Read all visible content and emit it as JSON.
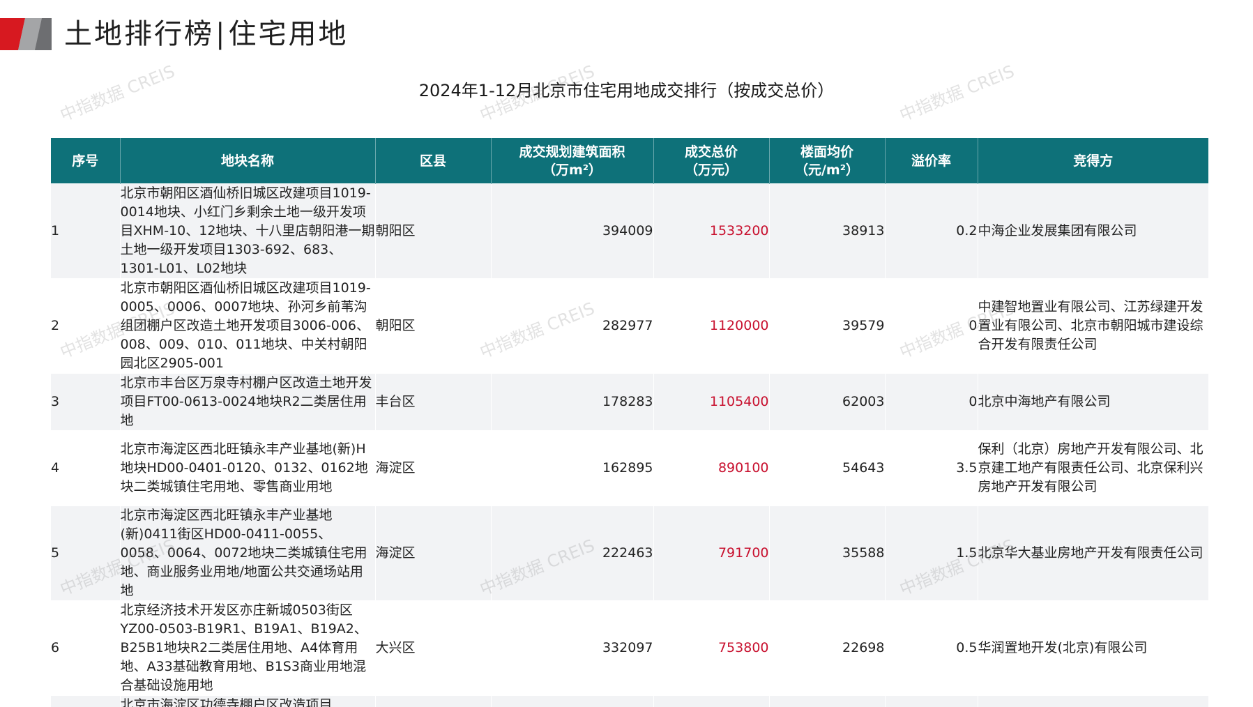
{
  "header": {
    "title_left": "土地排行榜",
    "title_sep": "|",
    "title_right": "住宅用地",
    "brand_red": "#d71920",
    "brand_gray": "#6d6e71"
  },
  "watermark": "中指数据 CREIS",
  "table": {
    "title": "2024年1-12月北京市住宅用地成交排行（按成交总价）",
    "header_color": "#0e7179",
    "price_color": "#c8102e",
    "columns": [
      {
        "line1": "序号",
        "line2": ""
      },
      {
        "line1": "地块名称",
        "line2": ""
      },
      {
        "line1": "区县",
        "line2": ""
      },
      {
        "line1": "成交规划建筑面积",
        "line2": "（万m²）"
      },
      {
        "line1": "成交总价",
        "line2": "（万元）"
      },
      {
        "line1": "楼面均价",
        "line2": "（元/m²）"
      },
      {
        "line1": "溢价率",
        "line2": ""
      },
      {
        "line1": "竞得方",
        "line2": ""
      }
    ],
    "rows": [
      {
        "rank": "1",
        "name": "北京市朝阳区酒仙桥旧城区改建项目1019-0014地块、小红门乡剩余土地一级开发项目XHM-10、12地块、十八里店朝阳港一期土地一级开发项目1303-692、683、1301-L01、L02地块",
        "district": "朝阳区",
        "area": "394009",
        "total": "1533200",
        "unit_price": "38913",
        "premium": "0.2",
        "winner": "中海企业发展集团有限公司"
      },
      {
        "rank": "2",
        "name": "北京市朝阳区酒仙桥旧城区改建项目1019-0005、0006、0007地块、孙河乡前苇沟组团棚户区改造土地开发项目3006-006、008、009、010、011地块、中关村朝阳园北区2905-001",
        "district": "朝阳区",
        "area": "282977",
        "total": "1120000",
        "unit_price": "39579",
        "premium": "0",
        "winner": "中建智地置业有限公司、江苏绿建开发置业有限公司、北京市朝阳城市建设综合开发有限责任公司"
      },
      {
        "rank": "3",
        "name": "北京市丰台区万泉寺村棚户区改造土地开发项目FT00-0613-0024地块R2二类居住用地",
        "district": "丰台区",
        "area": "178283",
        "total": "1105400",
        "unit_price": "62003",
        "premium": "0",
        "winner": "北京中海地产有限公司"
      },
      {
        "rank": "4",
        "name": "北京市海淀区西北旺镇永丰产业基地(新)H地块HD00-0401-0120、0132、0162地块二类城镇住宅用地、零售商业用地",
        "district": "海淀区",
        "area": "162895",
        "total": "890100",
        "unit_price": "54643",
        "premium": "3.5",
        "winner": "保利（北京）房地产开发有限公司、北京建工地产有限责任公司、北京保利兴房地产开发有限公司"
      },
      {
        "rank": "5",
        "name": "北京市海淀区西北旺镇永丰产业基地(新)0411街区HD00-0411-0055、0058、0064、0072地块二类城镇住宅用地、商业服务业用地/地面公共交通场站用地",
        "district": "海淀区",
        "area": "222463",
        "total": "791700",
        "unit_price": "35588",
        "premium": "1.5",
        "winner": "北京华大基业房地产开发有限责任公司"
      },
      {
        "rank": "6",
        "name": "北京经济技术开发区亦庄新城0503街区YZ00-0503-B19R1、B19A1、B19A2、B25B1地块R2二类居住用地、A4体育用地、A33基础教育用地、B1S3商业用地混合基础设施用地",
        "district": "大兴区",
        "area": "332097",
        "total": "753800",
        "unit_price": "22698",
        "premium": "0.5",
        "winner": "华润置地开发(北京)有限公司"
      },
      {
        "rank": "",
        "name": "北京市海淀区功德寺棚户区改造项目",
        "district": "",
        "area": "",
        "total": "",
        "unit_price": "",
        "premium": "",
        "winner": ""
      }
    ]
  }
}
